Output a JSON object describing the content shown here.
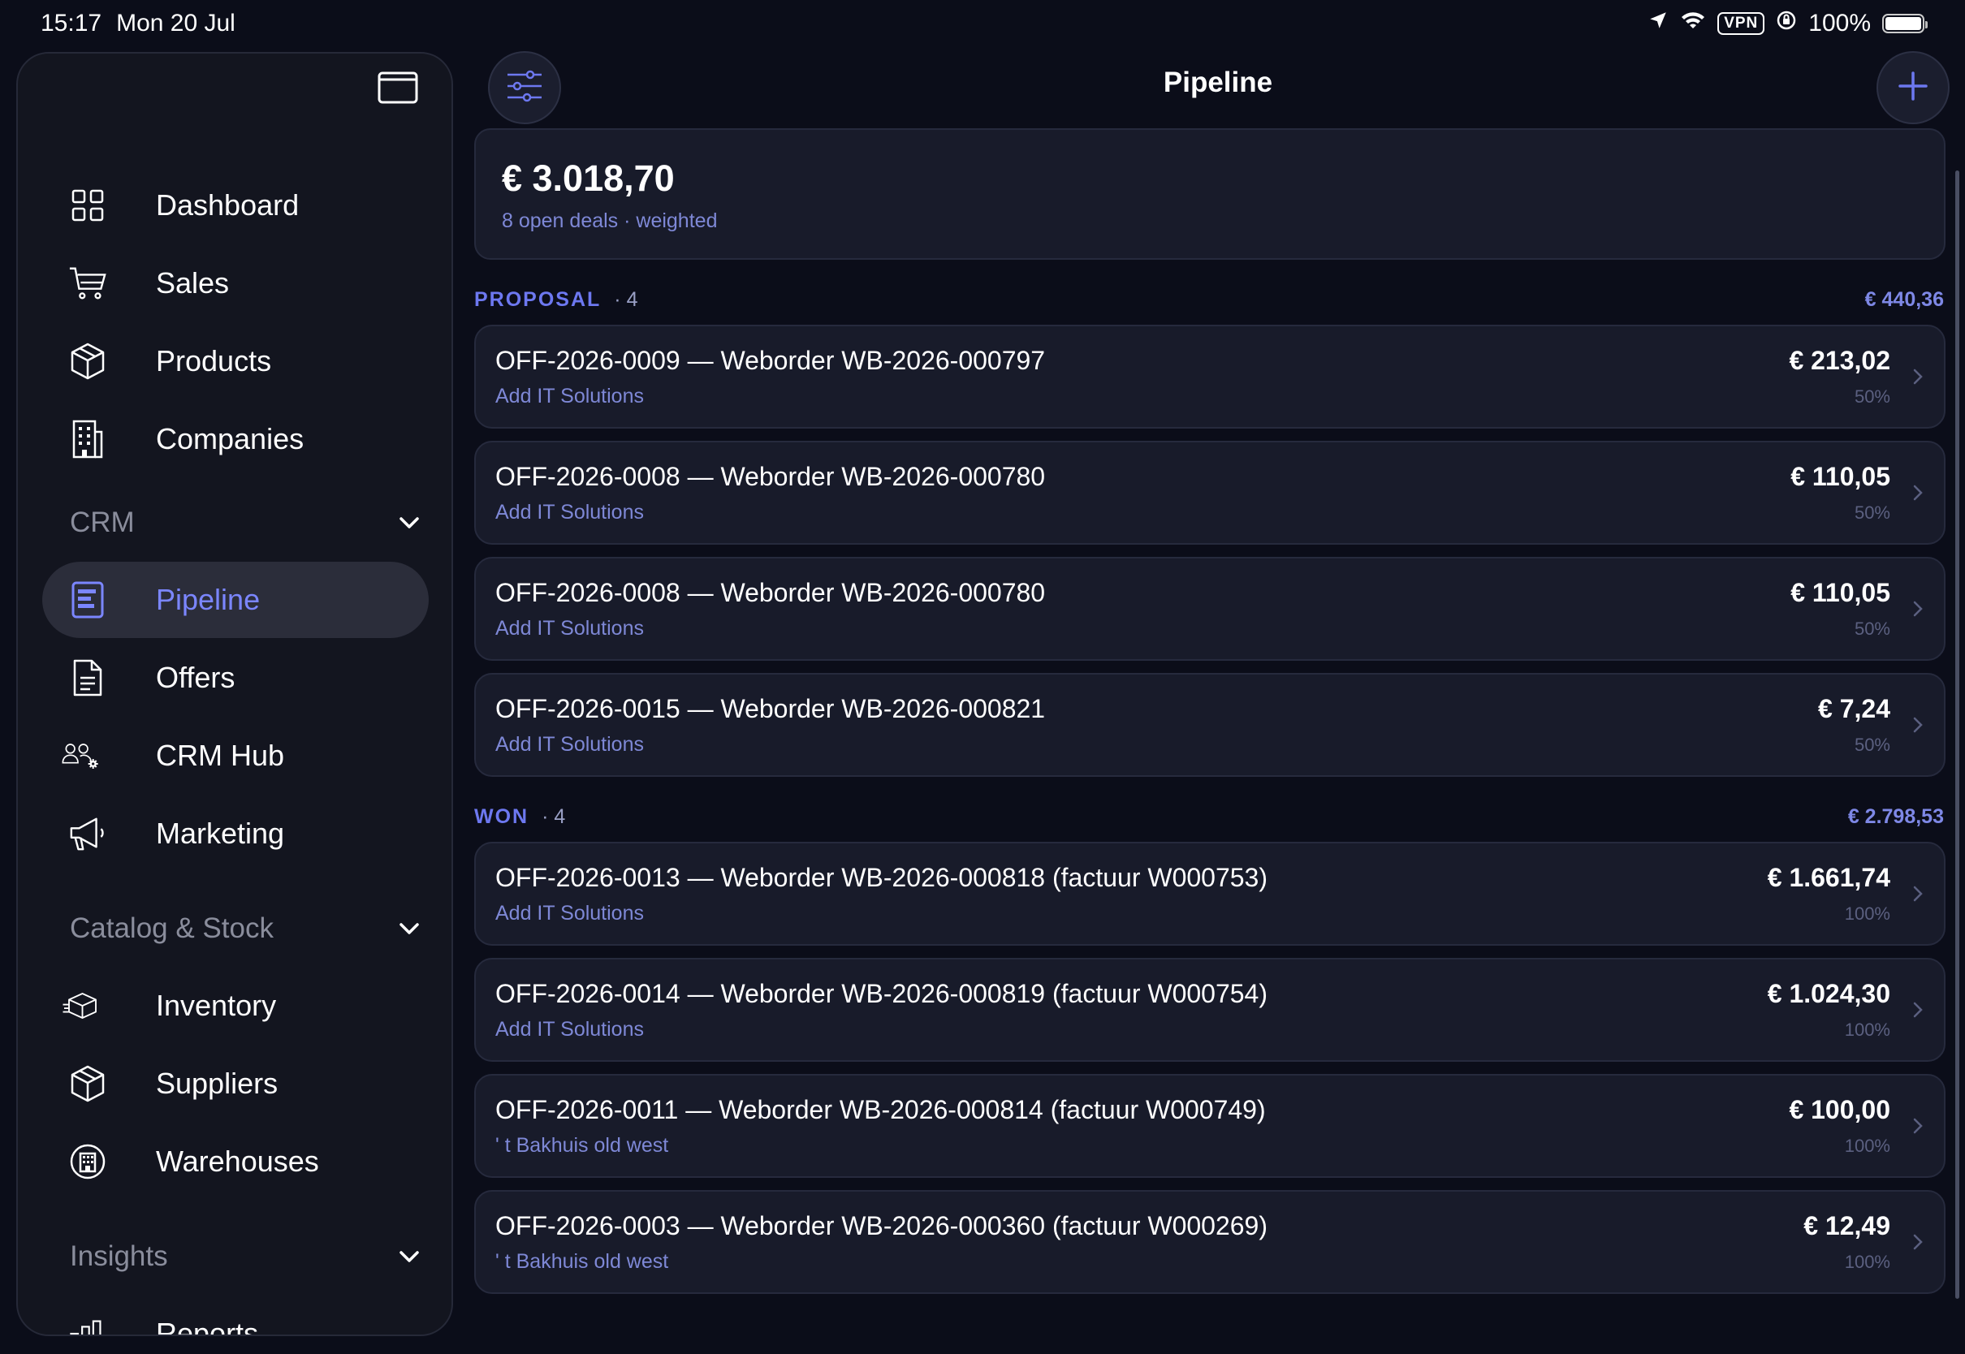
{
  "status_bar": {
    "time": "15:17",
    "date": "Mon 20 Jul",
    "vpn": "VPN",
    "battery": "100%",
    "battery_level": 1.0
  },
  "sidebar": {
    "main_items": [
      {
        "label": "Dashboard",
        "icon": "grid-icon"
      },
      {
        "label": "Sales",
        "icon": "cart-icon"
      },
      {
        "label": "Products",
        "icon": "box-icon"
      },
      {
        "label": "Companies",
        "icon": "building-icon"
      }
    ],
    "sections": [
      {
        "label": "CRM",
        "items": [
          {
            "label": "Pipeline",
            "icon": "pipeline-icon",
            "active": true
          },
          {
            "label": "Offers",
            "icon": "document-icon"
          },
          {
            "label": "CRM Hub",
            "icon": "people-gear-icon"
          },
          {
            "label": "Marketing",
            "icon": "megaphone-icon"
          }
        ]
      },
      {
        "label": "Catalog & Stock",
        "items": [
          {
            "label": "Inventory",
            "icon": "box-arrows-icon"
          },
          {
            "label": "Suppliers",
            "icon": "box-icon"
          },
          {
            "label": "Warehouses",
            "icon": "warehouse-icon"
          }
        ]
      },
      {
        "label": "Insights",
        "items": [
          {
            "label": "Reports",
            "icon": "bar-chart-icon"
          }
        ]
      }
    ]
  },
  "header": {
    "title": "Pipeline"
  },
  "summary": {
    "amount": "€ 3.018,70",
    "subtitle": "8 open deals · weighted"
  },
  "groups": [
    {
      "label": "PROPOSAL",
      "count": "· 4",
      "total": "€ 440,36",
      "deals": [
        {
          "title": "OFF-2026-0009 — Weborder WB-2026-000797",
          "company": "Add IT Solutions",
          "amount": "€ 213,02",
          "probability": "50%"
        },
        {
          "title": "OFF-2026-0008 — Weborder WB-2026-000780",
          "company": "Add IT Solutions",
          "amount": "€ 110,05",
          "probability": "50%"
        },
        {
          "title": "OFF-2026-0008 — Weborder WB-2026-000780",
          "company": "Add IT Solutions",
          "amount": "€ 110,05",
          "probability": "50%"
        },
        {
          "title": "OFF-2026-0015 — Weborder WB-2026-000821",
          "company": "Add IT Solutions",
          "amount": "€ 7,24",
          "probability": "50%"
        }
      ]
    },
    {
      "label": "WON",
      "count": "· 4",
      "total": "€ 2.798,53",
      "deals": [
        {
          "title": "OFF-2026-0013 — Weborder WB-2026-000818 (factuur W000753)",
          "company": "Add IT Solutions",
          "amount": "€ 1.661,74",
          "probability": "100%"
        },
        {
          "title": "OFF-2026-0014 — Weborder WB-2026-000819 (factuur W000754)",
          "company": "Add IT Solutions",
          "amount": "€ 1.024,30",
          "probability": "100%"
        },
        {
          "title": "OFF-2026-0011 — Weborder WB-2026-000814 (factuur W000749)",
          "company": "' t Bakhuis old west",
          "amount": "€ 100,00",
          "probability": "100%"
        },
        {
          "title": "OFF-2026-0003 — Weborder WB-2026-000360 (factuur W000269)",
          "company": "' t Bakhuis old west",
          "amount": "€ 12,49",
          "probability": "100%"
        }
      ]
    }
  ],
  "colors": {
    "accent": "#6d78f0",
    "background": "#0b0d19",
    "card": "#181b2a",
    "sidebar": "#13151f"
  }
}
